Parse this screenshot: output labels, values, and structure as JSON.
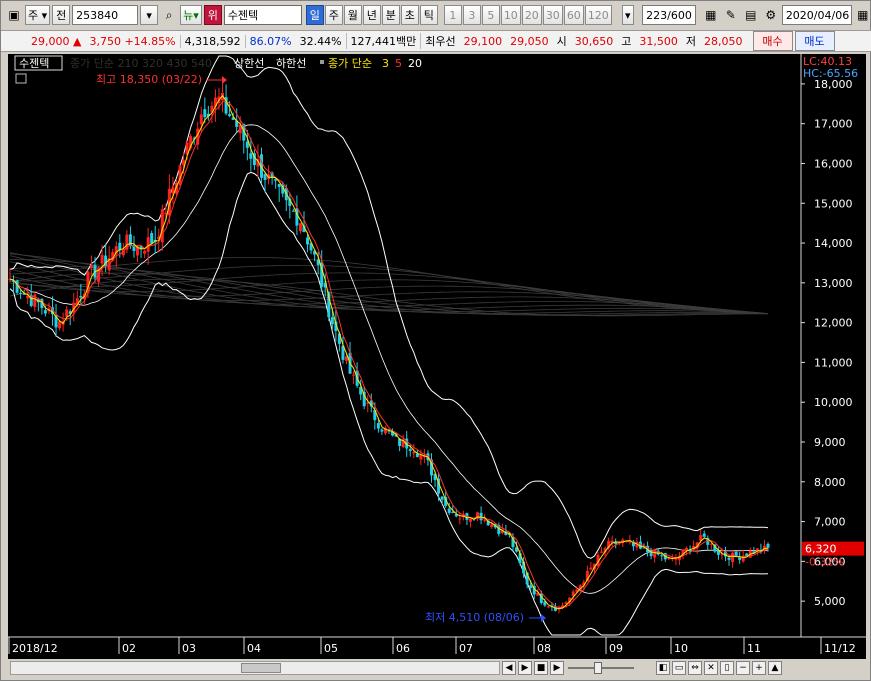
{
  "toolbar": {
    "market_label": "주",
    "all_label": "전",
    "code": "253840",
    "news_label": "뉴",
    "stock_badge": "위",
    "stock_name": "수젠텍",
    "periods": [
      "일",
      "주",
      "월",
      "년",
      "분",
      "초",
      "틱"
    ],
    "active_period": "일",
    "intervals": [
      "1",
      "3",
      "5",
      "10",
      "20",
      "30",
      "60",
      "120"
    ],
    "count": "223",
    "count_total": "/600",
    "date": "2020/04/06"
  },
  "quote": {
    "price": "29,000",
    "arrow": "▲",
    "change": "3,750",
    "change_pct": "+14.85%",
    "volume": "4,318,592",
    "vol_ratio": "86.07%",
    "turnover": "32.44%",
    "amount": "127,441백만",
    "best_label": "최우선",
    "best_ask": "29,100",
    "best_bid": "29,050",
    "open_label": "시",
    "open": "30,650",
    "high_label": "고",
    "high": "31,500",
    "low_label": "저",
    "low": "28,050",
    "buy_label": "매수",
    "sell_label": "매도"
  },
  "legend": {
    "stock": "수젠텍",
    "ma_long": "종가 단순 210 320 430 540",
    "upper": "상한선",
    "lower": "하한선",
    "ma_short_label": "종가 단순",
    "ma3": "3",
    "ma5": "5",
    "ma20": "20"
  },
  "annotations": {
    "high": "최고 18,350 (03/22)",
    "low": "최저 4,510 (08/06)",
    "lc": "LC:40.13",
    "hc": "HC:-65.56",
    "price_badge": "6,320",
    "pct_label": "-0.32%"
  },
  "axis": {
    "y_ticks": [
      "18,000",
      "17,000",
      "16,000",
      "15,000",
      "14,000",
      "13,000",
      "12,000",
      "11,000",
      "10,000",
      "9,000",
      "8,000",
      "7,000",
      "6,000",
      "5,000"
    ],
    "x_ticks": [
      "2018/12",
      "02",
      "03",
      "04",
      "05",
      "06",
      "07",
      "08",
      "09",
      "10",
      "11",
      "11/12"
    ]
  },
  "chart_data": {
    "type": "candlestick",
    "ylim": [
      4300,
      18500
    ],
    "x_axis_labels": [
      "2018/12",
      "02",
      "03",
      "04",
      "05",
      "06",
      "07",
      "08",
      "09",
      "10",
      "11",
      "11/12"
    ],
    "close_series": [
      13100,
      12700,
      12400,
      12000,
      12500,
      13200,
      13600,
      14000,
      13900,
      14100,
      15300,
      16400,
      17400,
      17600,
      17000,
      16200,
      15600,
      15000,
      14600,
      13500,
      12000,
      10800,
      10000,
      9400,
      9000,
      8900,
      8400,
      7400,
      7100,
      7200,
      6900,
      6600,
      5500,
      5000,
      4800,
      5200,
      5800,
      6400,
      6500,
      6300,
      6200,
      6000,
      6300,
      6600,
      6200,
      6100,
      6250,
      6320
    ],
    "high_point": {
      "value": 18350,
      "date": "03/22"
    },
    "low_point": {
      "value": 4510,
      "date": "08/06"
    },
    "last_value": 6320,
    "series": [
      {
        "name": "3",
        "color": "#ffe800"
      },
      {
        "name": "5",
        "color": "#ff3030"
      },
      {
        "name": "20",
        "color": "#ffffff"
      },
      {
        "name": "상한선",
        "color": "#ffffff"
      },
      {
        "name": "하한선",
        "color": "#ffffff"
      }
    ]
  }
}
